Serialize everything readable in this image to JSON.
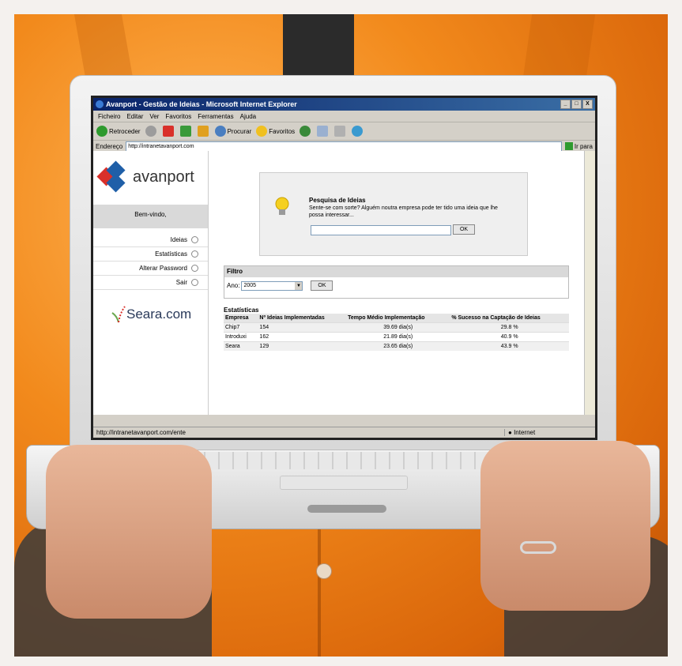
{
  "browser": {
    "window_title": "Avanport - Gestão de Ideias - Microsoft Internet Explorer",
    "window_buttons": [
      "_",
      "□",
      "X"
    ],
    "menu": [
      "Ficheiro",
      "Editar",
      "Ver",
      "Favoritos",
      "Ferramentas",
      "Ajuda"
    ],
    "toolbar": {
      "back_label": "Retroceder",
      "search_label": "Procurar",
      "favorites_label": "Favoritos"
    },
    "address_label": "Endereço",
    "address_value": "http://intranetavanport.com",
    "go_label": "Ir para",
    "status_url": "http://intranetavanport.com/ente",
    "status_zone": "Internet"
  },
  "sidebar": {
    "logo_text": "avanport",
    "welcome": "Bem-vindo,",
    "nav": [
      "Ideias",
      "Estatísticas",
      "Alterar Password",
      "Sair"
    ],
    "partner_logo_text": "Seara.com"
  },
  "search": {
    "title": "Pesquisa de Ideias",
    "subtitle": "Sente-se com sorte? Alguém noutra empresa pode ter tido uma ideia que lhe possa interessar...",
    "input_value": "",
    "button_label": "OK"
  },
  "filter": {
    "title": "Filtro",
    "year_label": "Ano:",
    "year_value": "2005",
    "button_label": "OK"
  },
  "stats": {
    "title": "Estatísticas",
    "columns": [
      "Empresa",
      "Nº Ideias Implementadas",
      "Tempo Médio Implementação",
      "% Sucesso na Captação de Ideias"
    ],
    "rows": [
      [
        "Chip7",
        "154",
        "39.69 dia(s)",
        "29.8 %"
      ],
      [
        "Introduxi",
        "162",
        "21.89 dia(s)",
        "40.9 %"
      ],
      [
        "Seara",
        "129",
        "23.65 dia(s)",
        "43.9 %"
      ]
    ]
  },
  "colors": {
    "shirt": "#f28a1c",
    "titlebar": "#0a246a",
    "avanport_blue": "#1f5fa8",
    "avanport_red": "#d9302a",
    "seara_red": "#d9302a",
    "seara_green": "#6aa84f"
  }
}
